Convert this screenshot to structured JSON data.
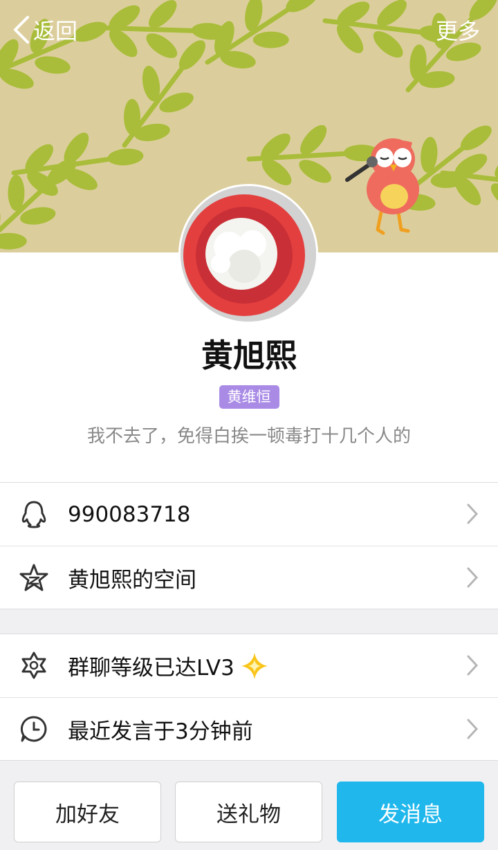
{
  "topbar": {
    "back_label": "返回",
    "more_label": "更多"
  },
  "profile": {
    "name": "黄旭熙",
    "group_nickname": "黄维恒",
    "signature": "我不去了，免得白挨一顿毒打十几个人的"
  },
  "info_rows": [
    {
      "icon": "qq-penguin-icon",
      "label": "990083718"
    },
    {
      "icon": "qzone-star-icon",
      "label": "黄旭熙的空间"
    }
  ],
  "group_rows": [
    {
      "icon": "star-level-icon",
      "label": "群聊等级已达LV3"
    },
    {
      "icon": "clock-icon",
      "label": "最近发言于3分钟前"
    }
  ],
  "actions": {
    "add_friend": "加好友",
    "send_gift": "送礼物",
    "send_message": "发消息"
  },
  "colors": {
    "banner_bg": "#dcce9c",
    "leaf": "#a9bd3a",
    "badge": "#a98be6",
    "primary_button": "#1fb7ec"
  }
}
